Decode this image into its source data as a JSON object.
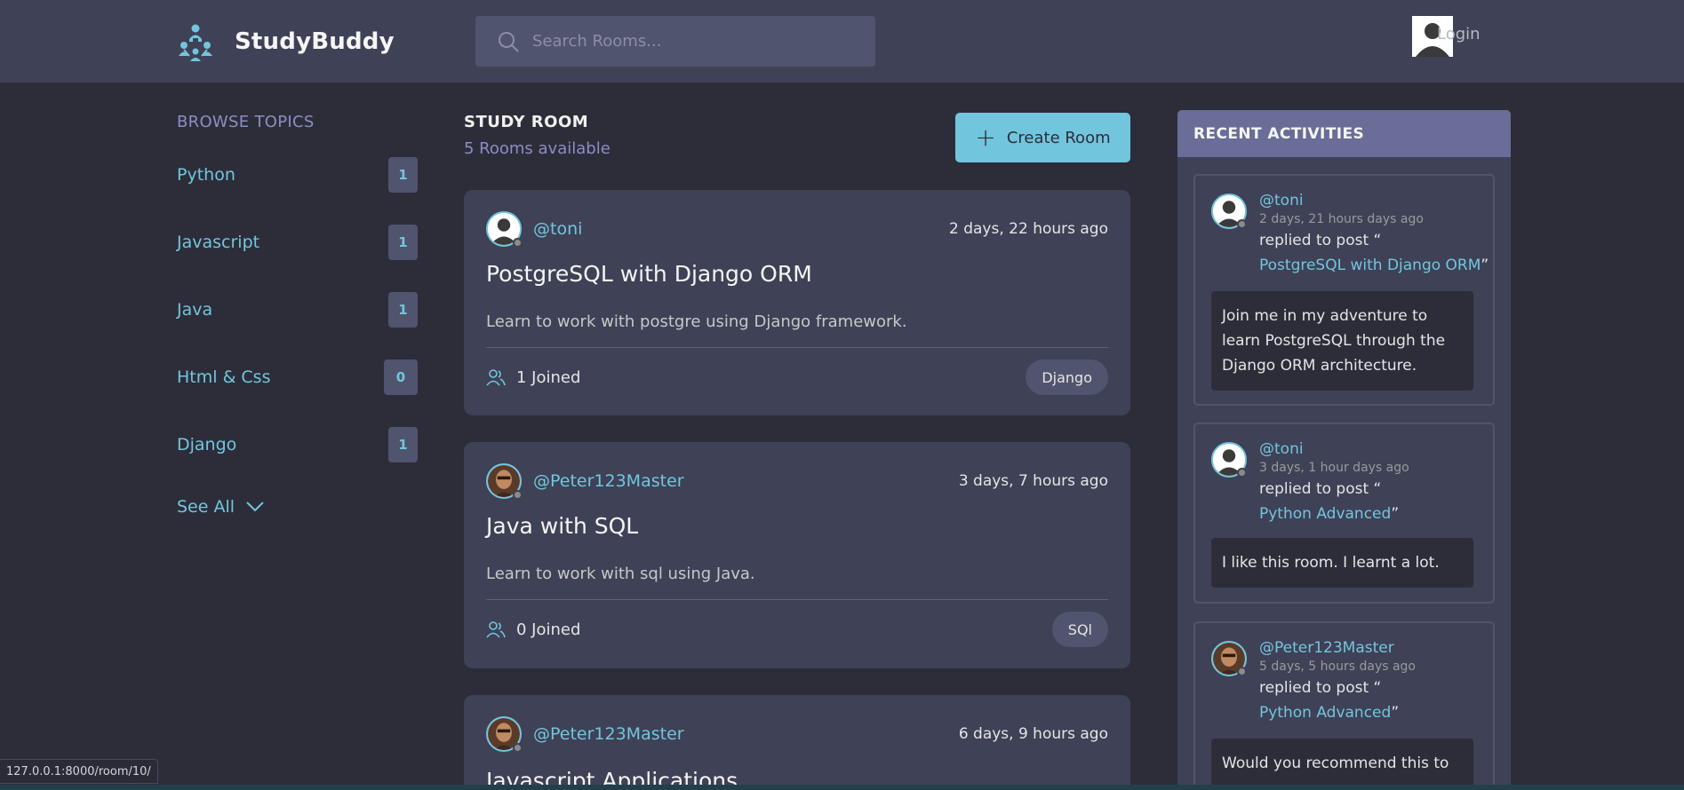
{
  "header": {
    "brand": "StudyBuddy",
    "search_placeholder": "Search Rooms...",
    "login_label": "Login"
  },
  "sidebar": {
    "title": "BROWSE TOPICS",
    "topics": [
      {
        "name": "Python",
        "count": "1"
      },
      {
        "name": "Javascript",
        "count": "1"
      },
      {
        "name": "Java",
        "count": "1"
      },
      {
        "name": "Html & Css",
        "count": "0"
      },
      {
        "name": "Django",
        "count": "1"
      }
    ],
    "see_all_label": "See All"
  },
  "main": {
    "heading": "STUDY ROOM",
    "rooms_available": "5 Rooms available",
    "create_button_label": "Create Room",
    "rooms": [
      {
        "host": "@toni",
        "time": "2 days, 22 hours ago",
        "title": "PostgreSQL with Django ORM",
        "description": "Learn to work with postgre using Django framework.",
        "joined": "1 Joined",
        "topic": "Django"
      },
      {
        "host": "@Peter123Master",
        "time": "3 days, 7 hours ago",
        "title": "Java with SQL",
        "description": "Learn to work with sql using Java.",
        "joined": "0 Joined",
        "topic": "SQl"
      },
      {
        "host": "@Peter123Master",
        "time": "6 days, 9 hours ago",
        "title": "Javascript Applications"
      }
    ]
  },
  "activities": {
    "title": "RECENT ACTIVITIES",
    "items": [
      {
        "user": "@toni",
        "time": "2 days, 21 hours days ago",
        "action": "replied to post “",
        "post": "PostgreSQL with Django ORM",
        "message": "Join me in my adventure to learn PostgreSQL through the Django ORM architecture."
      },
      {
        "user": "@toni",
        "time": "3 days, 1 hour days ago",
        "action": "replied to post “",
        "post": "Python Advanced",
        "message": "I like this room. I learnt a lot."
      },
      {
        "user": "@Peter123Master",
        "time": "5 days, 5 hours days ago",
        "action": "replied to post “",
        "post": "Python Advanced",
        "message": "Would you recommend this to ..."
      }
    ],
    "close_quote": "”"
  },
  "status_bar": {
    "url": "127.0.0.1:8000/room/10/"
  },
  "colors": {
    "background": "#2d2d39",
    "panel": "#3f4156",
    "accent": "#71c6dd",
    "muted_purple": "#8b8ec4",
    "activities_header": "#696d97"
  }
}
